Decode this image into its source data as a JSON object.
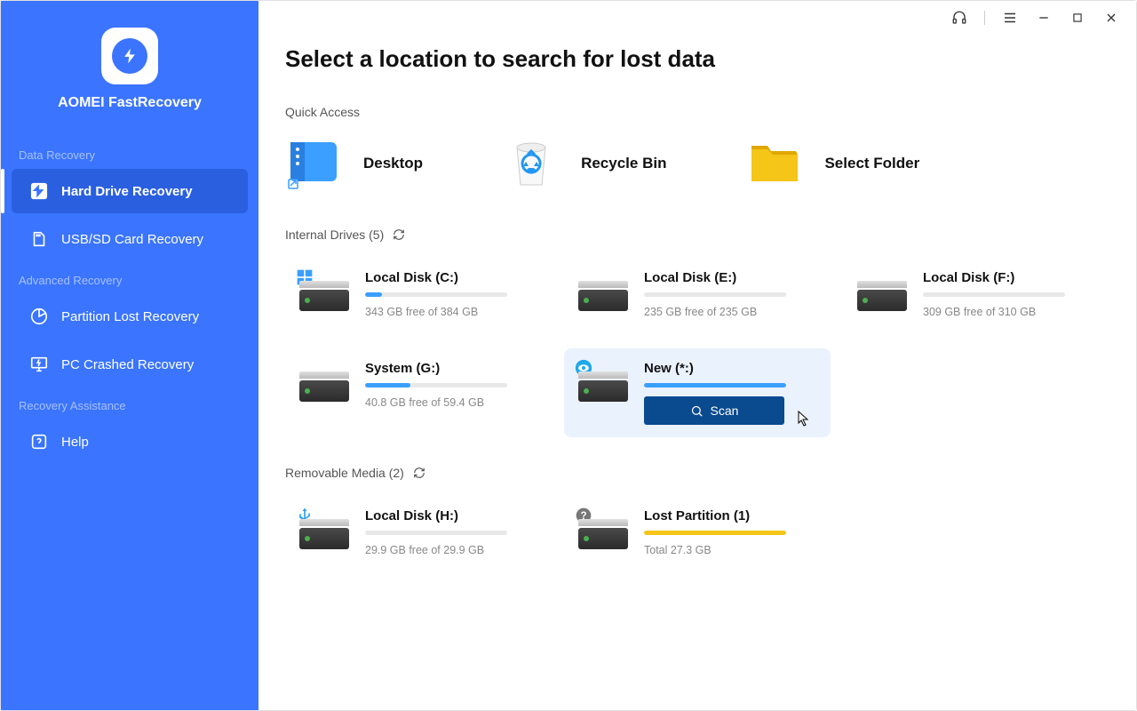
{
  "app_name": "AOMEI FastRecovery",
  "sidebar": {
    "sections": [
      {
        "label": "Data Recovery",
        "items": [
          {
            "label": "Hard Drive Recovery",
            "active": true
          },
          {
            "label": "USB/SD Card Recovery",
            "active": false
          }
        ]
      },
      {
        "label": "Advanced Recovery",
        "items": [
          {
            "label": "Partition Lost Recovery",
            "active": false
          },
          {
            "label": "PC Crashed Recovery",
            "active": false
          }
        ]
      },
      {
        "label": "Recovery Assistance",
        "items": [
          {
            "label": "Help",
            "active": false
          }
        ]
      }
    ]
  },
  "page_title": "Select a location to search for lost data",
  "quick_access": {
    "label": "Quick Access",
    "items": [
      {
        "label": "Desktop"
      },
      {
        "label": "Recycle Bin"
      },
      {
        "label": "Select Folder"
      }
    ]
  },
  "internal_drives": {
    "label": "Internal Drives (5)",
    "items": [
      {
        "name": "Local Disk (C:)",
        "free": "343 GB free of 384 GB",
        "fill": 12,
        "badge": "windows"
      },
      {
        "name": "Local Disk (E:)",
        "free": "235 GB free of 235 GB",
        "fill": 0
      },
      {
        "name": "Local Disk (F:)",
        "free": "309 GB free of 310 GB",
        "fill": 0
      },
      {
        "name": "System (G:)",
        "free": "40.8 GB free of 59.4 GB",
        "fill": 32
      },
      {
        "name": "New (*:)",
        "free": "",
        "fill": 100,
        "selected": true,
        "badge": "eye",
        "scan_label": "Scan"
      }
    ]
  },
  "removable_media": {
    "label": "Removable Media (2)",
    "items": [
      {
        "name": "Local Disk (H:)",
        "free": "29.9 GB free of 29.9 GB",
        "fill": 0,
        "badge": "usb"
      },
      {
        "name": "Lost Partition (1)",
        "free": "Total 27.3 GB",
        "fill": 100,
        "badge": "question",
        "yellow": true
      }
    ]
  }
}
